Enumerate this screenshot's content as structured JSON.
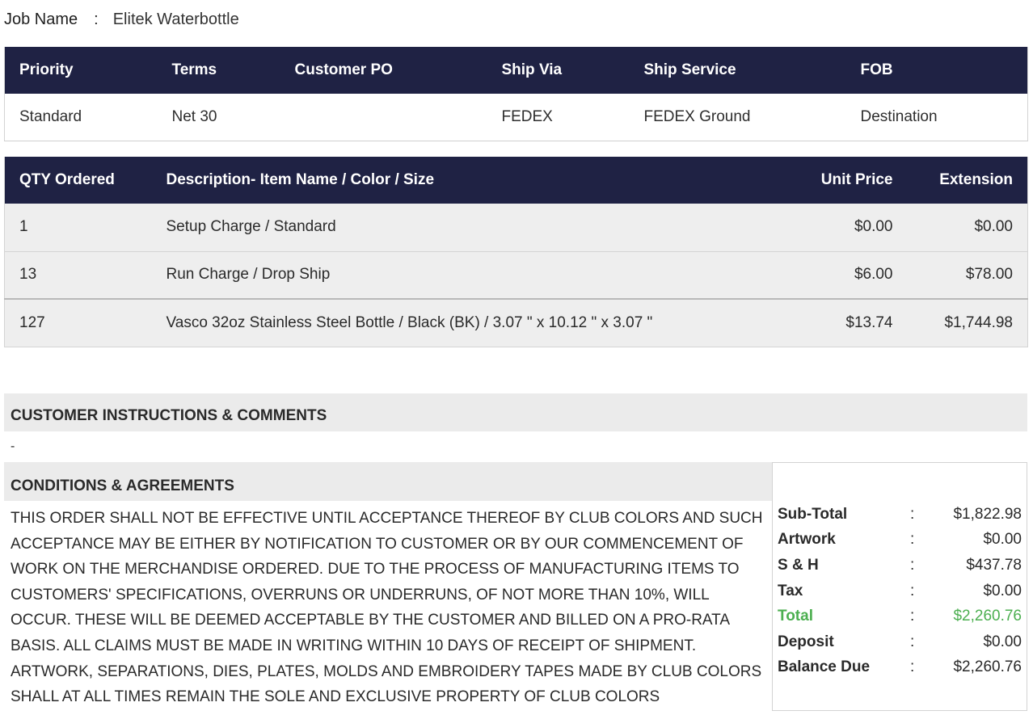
{
  "job": {
    "label": "Job Name",
    "separator": ":",
    "value": "Elitek Waterbottle"
  },
  "order_info": {
    "headers": [
      "Priority",
      "Terms",
      "Customer PO",
      "Ship Via",
      "Ship Service",
      "FOB"
    ],
    "row": [
      "Standard",
      "Net 30",
      "",
      "FEDEX",
      "FEDEX Ground",
      "Destination"
    ]
  },
  "items": {
    "headers": [
      "QTY Ordered",
      "Description- Item Name / Color / Size",
      "Unit Price",
      "Extension"
    ],
    "rows": [
      {
        "qty": "1",
        "description": "Setup Charge / Standard",
        "unit_price": "$0.00",
        "extension": "$0.00"
      },
      {
        "qty": "13",
        "description": "Run Charge / Drop Ship",
        "unit_price": "$6.00",
        "extension": "$78.00"
      },
      {
        "qty": "127",
        "description": "Vasco 32oz Stainless Steel Bottle / Black (BK) / 3.07 \" x 10.12 \" x 3.07 \"",
        "unit_price": "$13.74",
        "extension": "$1,744.98"
      }
    ]
  },
  "instructions": {
    "title": "CUSTOMER INSTRUCTIONS & COMMENTS",
    "body": "-"
  },
  "conditions": {
    "title": "CONDITIONS & AGREEMENTS",
    "body": "THIS ORDER SHALL NOT BE EFFECTIVE UNTIL ACCEPTANCE THEREOF BY CLUB COLORS AND SUCH ACCEPTANCE MAY BE EITHER BY NOTIFICATION TO CUSTOMER OR BY OUR COMMENCEMENT OF WORK ON THE MERCHANDISE ORDERED. DUE TO THE PROCESS OF MANUFACTURING ITEMS TO CUSTOMERS' SPECIFICATIONS, OVERRUNS OR UNDERRUNS, OF NOT MORE THAN 10%, WILL OCCUR. THESE WILL BE DEEMED ACCEPTABLE BY THE CUSTOMER AND BILLED ON A PRO-RATA BASIS. ALL CLAIMS MUST BE MADE IN WRITING WITHIN 10 DAYS OF RECEIPT OF SHIPMENT. ARTWORK, SEPARATIONS, DIES, PLATES, MOLDS AND EMBROIDERY TAPES MADE BY CLUB COLORS SHALL AT ALL TIMES REMAIN THE SOLE AND EXCLUSIVE PROPERTY OF CLUB COLORS"
  },
  "totals": {
    "separator": ":",
    "rows": [
      {
        "label": "Sub-Total",
        "value": "$1,822.98"
      },
      {
        "label": "Artwork",
        "value": "$0.00"
      },
      {
        "label": "S & H",
        "value": "$437.78"
      },
      {
        "label": "Tax",
        "value": "$0.00"
      },
      {
        "label": "Total",
        "value": "$2,260.76"
      },
      {
        "label": "Deposit",
        "value": "$0.00"
      },
      {
        "label": "Balance Due",
        "value": "$2,260.76"
      }
    ],
    "highlight_color": "#4caf50"
  },
  "colors": {
    "header_bg": "#1f2244",
    "row_bg": "#eeeeee",
    "section_bg": "#ebebeb"
  }
}
